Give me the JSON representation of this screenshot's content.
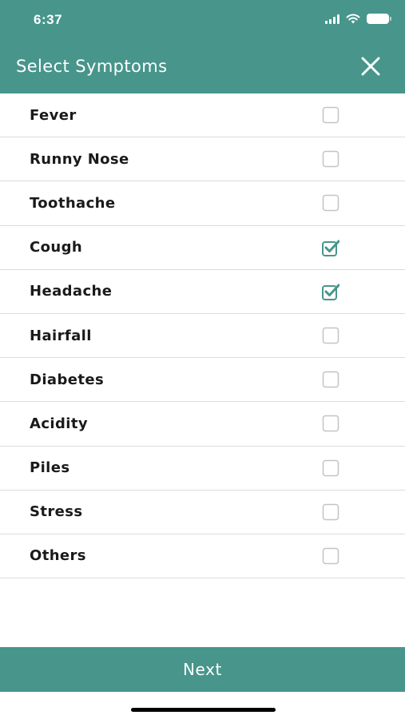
{
  "status_bar": {
    "time": "6:37",
    "icons": [
      "signal-icon",
      "wifi-icon",
      "battery-icon"
    ]
  },
  "header": {
    "title": "Select Symptoms",
    "close_icon": "close-icon"
  },
  "symptoms": [
    {
      "label": "Fever",
      "checked": false
    },
    {
      "label": "Runny Nose",
      "checked": false
    },
    {
      "label": "Toothache",
      "checked": false
    },
    {
      "label": "Cough",
      "checked": true
    },
    {
      "label": "Headache",
      "checked": true
    },
    {
      "label": "Hairfall",
      "checked": false
    },
    {
      "label": "Diabetes",
      "checked": false
    },
    {
      "label": "Acidity",
      "checked": false
    },
    {
      "label": "Piles",
      "checked": false
    },
    {
      "label": "Stress",
      "checked": false
    },
    {
      "label": "Others",
      "checked": false
    }
  ],
  "footer": {
    "next_label": "Next"
  },
  "colors": {
    "accent": "#47958b",
    "divider": "#dcdcdc",
    "checkbox_unchecked": "#c4c4c4"
  }
}
